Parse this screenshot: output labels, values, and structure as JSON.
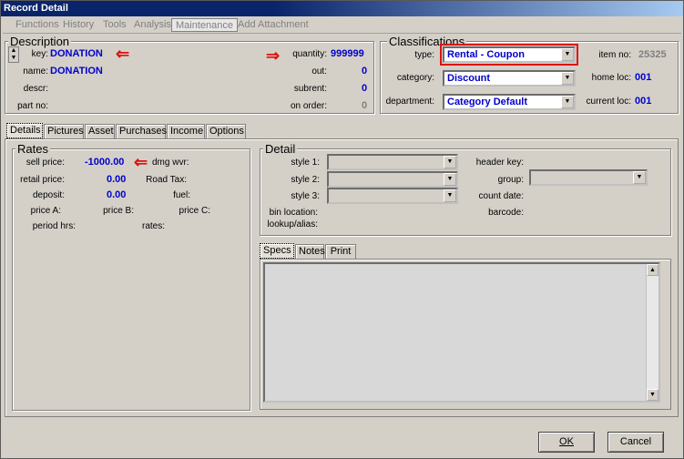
{
  "window": {
    "title": "Record Detail"
  },
  "menu": [
    "Functions",
    "History",
    "Tools",
    "Analysis",
    "Maintenance",
    "Add Attachment"
  ],
  "description": {
    "title": "Description",
    "key_label": "key:",
    "key_value": "DONATION",
    "name_label": "name:",
    "name_value": "DONATION",
    "descr_label": "descr:",
    "partno_label": "part no:",
    "quantity_label": "quantity:",
    "quantity_value": "999999",
    "out_label": "out:",
    "out_value": "0",
    "subrent_label": "subrent:",
    "subrent_value": "0",
    "onorder_label": "on order:",
    "onorder_value": "0"
  },
  "classifications": {
    "title": "Classifications",
    "type_label": "type:",
    "type_value": "Rental - Coupon",
    "category_label": "category:",
    "category_value": "Discount",
    "department_label": "department:",
    "department_value": "Category Default",
    "itemno_label": "item no:",
    "itemno_value": "25325",
    "homeloc_label": "home loc:",
    "homeloc_value": "001",
    "currentloc_label": "current loc:",
    "currentloc_value": "001"
  },
  "tabs": [
    "Details",
    "Pictures",
    "Asset",
    "Purchases",
    "Income",
    "Options"
  ],
  "rates": {
    "title": "Rates",
    "sell_label": "sell price:",
    "sell_value": "-1000.00",
    "dmg_label": "dmg wvr:",
    "retail_label": "retail price:",
    "retail_value": "0.00",
    "roadtax_label": "Road Tax:",
    "deposit_label": "deposit:",
    "deposit_value": "0.00",
    "fuel_label": "fuel:",
    "priceA_label": "price A:",
    "priceB_label": "price B:",
    "priceC_label": "price C:",
    "period_label": "period hrs:",
    "rates_label": "rates:"
  },
  "detail": {
    "title": "Detail",
    "style1_label": "style 1:",
    "style2_label": "style 2:",
    "style3_label": "style 3:",
    "bin_label": "bin location:",
    "lookup_label": "lookup/alias:",
    "headerkey_label": "header key:",
    "group_label": "group:",
    "countdate_label": "count date:",
    "barcode_label": "barcode:"
  },
  "subtabs": [
    "Specs",
    "Notes",
    "Print"
  ],
  "buttons": {
    "ok": "OK",
    "cancel": "Cancel"
  },
  "colors": {
    "accent_value": "#0000cc",
    "highlight_arrow": "#e01010"
  }
}
